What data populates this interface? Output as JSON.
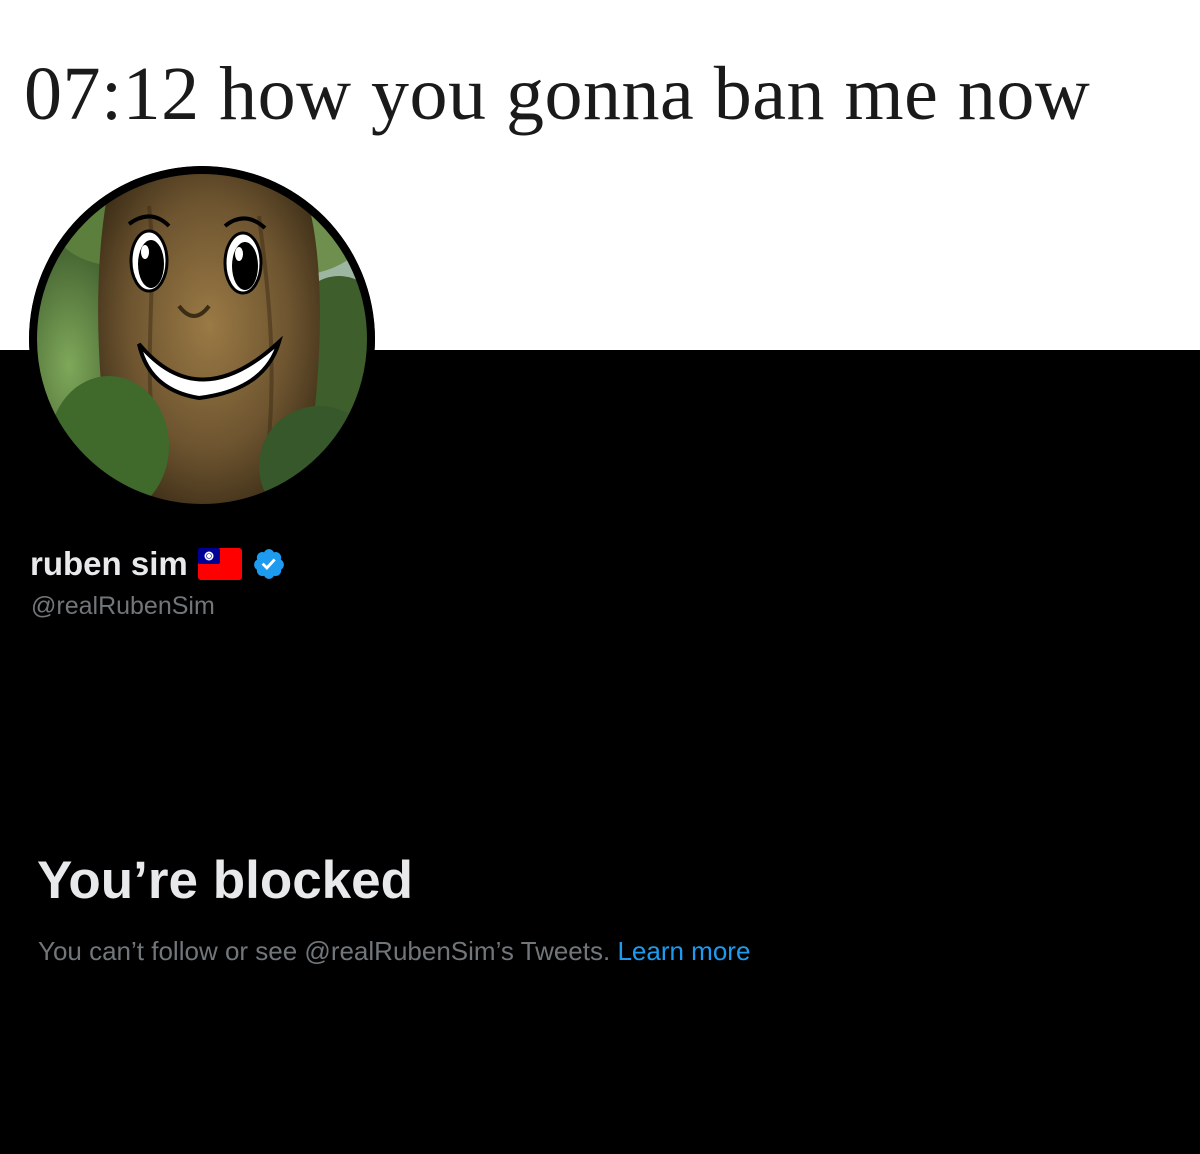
{
  "meme": {
    "caption": "07:12 how you gonna ban me now"
  },
  "profile": {
    "avatar_icon": "tree-face-avatar",
    "display_name": "ruben sim",
    "flag_icon": "taiwan-flag-icon",
    "verified_icon": "verified-badge-icon",
    "handle": "@realRubenSim"
  },
  "blocked": {
    "title": "You’re blocked",
    "message": "You can’t follow or see @realRubenSim’s Tweets.",
    "learn_more_label": "Learn more"
  },
  "colors": {
    "background_top": "#ffffff",
    "background_profile": "#000000",
    "primary_text": "#e7e9ea",
    "secondary_text": "#71767b",
    "link": "#1d9bf0",
    "verified": "#1d9bf0",
    "flag_red": "#fe0000",
    "flag_blue": "#000095"
  }
}
